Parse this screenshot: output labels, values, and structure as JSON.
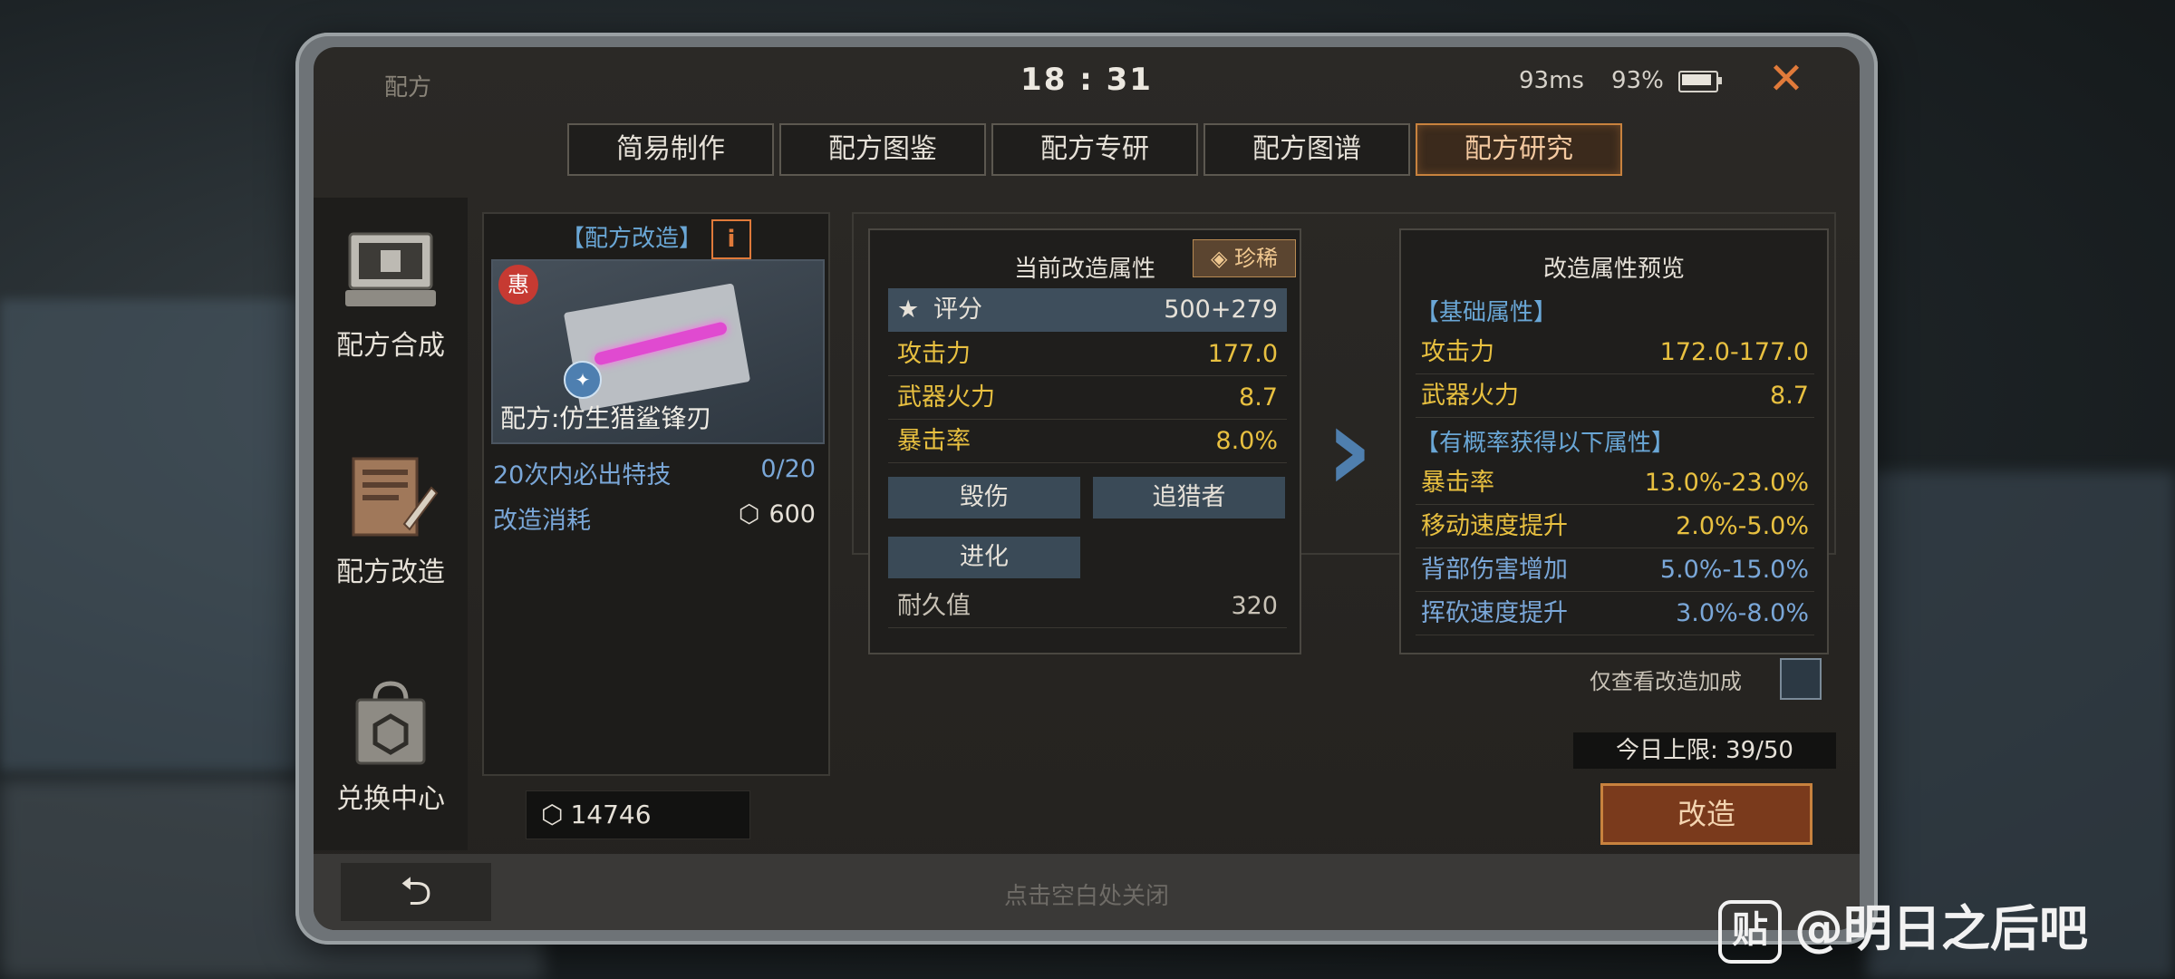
{
  "status": {
    "title": "配方",
    "time": "18 : 31",
    "ping": "93ms",
    "battery": "93%"
  },
  "tabs": [
    "简易制作",
    "配方图鉴",
    "配方专研",
    "配方图谱",
    "配方研究"
  ],
  "active_tab": "配方研究",
  "sidebar": [
    {
      "label": "配方合成",
      "icon": "terminal-icon"
    },
    {
      "label": "配方改造",
      "icon": "document-pen-icon"
    },
    {
      "label": "兑换中心",
      "icon": "shopping-bag-icon"
    }
  ],
  "recipe_panel": {
    "header": "【配方改造】",
    "info_icon": "i",
    "hui_badge": "惠",
    "recipe_name": "配方:仿生猎鲨锋刃",
    "guarantee_label": "20次内必出特技",
    "guarantee_value": "0/20",
    "cost_label": "改造消耗",
    "cost_value": "600",
    "balance": "14746"
  },
  "current": {
    "title": "当前改造属性",
    "rarity": "珍稀",
    "score_label": "评分",
    "score_value": "500+279",
    "attrs": [
      {
        "label": "攻击力",
        "value": "177.0"
      },
      {
        "label": "武器火力",
        "value": "8.7"
      },
      {
        "label": "暴击率",
        "value": "8.0%"
      }
    ],
    "skills": [
      "毁伤",
      "追猎者",
      "进化"
    ],
    "durability_label": "耐久值",
    "durability_value": "320"
  },
  "preview": {
    "title": "改造属性预览",
    "base_header": "【基础属性】",
    "base_attrs": [
      {
        "label": "攻击力",
        "value": "172.0-177.0"
      },
      {
        "label": "武器火力",
        "value": "8.7"
      }
    ],
    "chance_header": "【有概率获得以下属性】",
    "chance_attrs": [
      {
        "label": "暴击率",
        "value": "13.0%-23.0%",
        "color": "yellow"
      },
      {
        "label": "移动速度提升",
        "value": "2.0%-5.0%",
        "color": "yellow"
      },
      {
        "label": "背部伤害增加",
        "value": "5.0%-15.0%",
        "color": "blue"
      },
      {
        "label": "挥砍速度提升",
        "value": "3.0%-8.0%",
        "color": "blue"
      }
    ]
  },
  "only_view_label": "仅查看改造加成",
  "daily_limit": "今日上限:  39/50",
  "reforge_button": "改造",
  "close_hint": "点击空白处关闭",
  "watermark": "@明日之后吧",
  "watermark_icon": "贴"
}
